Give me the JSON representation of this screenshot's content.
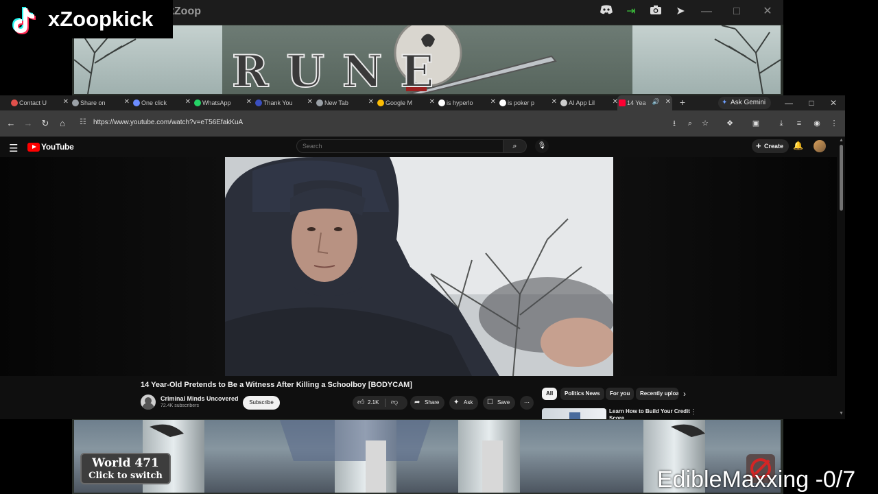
{
  "game": {
    "title_fragment": "kZoop",
    "logo_text": "RUNE",
    "world_number": "World 471",
    "world_hint": "Click to switch"
  },
  "overlay": {
    "tiktok_handle": "xZoopkick",
    "bottom_caption": "EdibleMaxxing -0/7"
  },
  "browser": {
    "tabs": [
      {
        "label": "Contact U",
        "fav_color": "#e0504b"
      },
      {
        "label": "Share on",
        "fav_color": "#9aa0a6"
      },
      {
        "label": "One click",
        "fav_color": "#6b8cff"
      },
      {
        "label": "WhatsApp",
        "fav_color": "#25d366"
      },
      {
        "label": "Thank You",
        "fav_color": "#3a4fbf"
      },
      {
        "label": "New Tab",
        "fav_color": "#9aa0a6"
      },
      {
        "label": "Google M",
        "fav_color": "#fbbc04"
      },
      {
        "label": "is hyperlo",
        "fav_color": "#ffffff"
      },
      {
        "label": "is poker p",
        "fav_color": "#ffffff"
      },
      {
        "label": "AI App Lil",
        "fav_color": "#cccccc"
      },
      {
        "label": "14 Yea",
        "fav_color": "#ff0033"
      }
    ],
    "ask_gemini": "Ask Gemini",
    "url": "https://www.youtube.com/watch?v=eT56EfakKuA"
  },
  "youtube": {
    "logo_text": "YouTube",
    "search_placeholder": "Search",
    "create_label": "Create",
    "video_title": "14 Year-Old Pretends to Be a Witness After Killing a Schoolboy [BODYCAM]",
    "channel_name": "Criminal Minds Uncovered",
    "subscriber_count": "72.4K subscribers",
    "subscribe_label": "Subscribe",
    "like_count": "2.1K",
    "share_label": "Share",
    "ask_label": "Ask",
    "save_label": "Save",
    "chips": [
      "All",
      "Politics News",
      "For you",
      "Recently uploaded"
    ],
    "recommended": [
      {
        "title": "Learn How to Build Your Credit Score"
      }
    ]
  },
  "colors": {
    "youtube_red": "#ff0000",
    "page_bg": "#0f0f0f",
    "chip_active": "#f1f1f1"
  }
}
